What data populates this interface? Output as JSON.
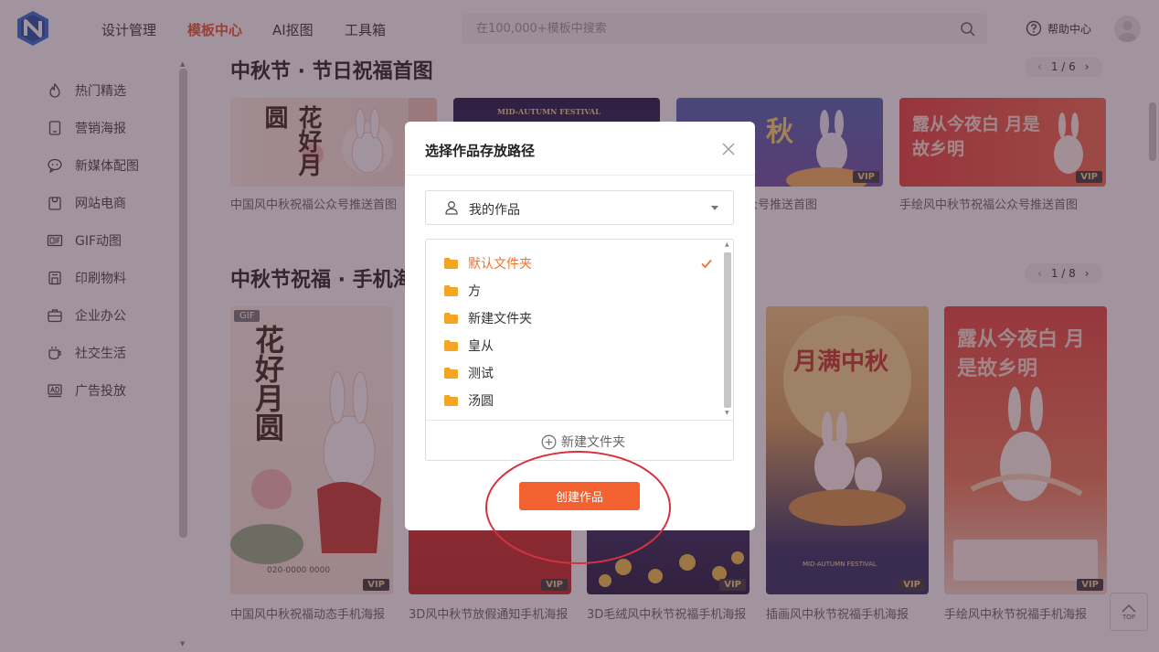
{
  "header": {
    "nav": [
      {
        "label": "设计管理",
        "active": false
      },
      {
        "label": "模板中心",
        "active": true
      },
      {
        "label": "AI抠图",
        "active": false
      },
      {
        "label": "工具箱",
        "active": false
      }
    ],
    "search_placeholder": "在100,000+模板中搜索",
    "help_label": "帮助中心",
    "icons": {
      "logo": "n-logo-icon",
      "search": "search-icon",
      "help": "question-circle-icon",
      "avatar": "user-avatar"
    }
  },
  "sidebar": {
    "items": [
      {
        "label": "热门精选",
        "icon": "flame-icon"
      },
      {
        "label": "营销海报",
        "icon": "tablet-icon"
      },
      {
        "label": "新媒体配图",
        "icon": "chat-icon"
      },
      {
        "label": "网站电商",
        "icon": "shop-bag-icon"
      },
      {
        "label": "GIF动图",
        "icon": "gif-icon"
      },
      {
        "label": "印刷物料",
        "icon": "printer-icon"
      },
      {
        "label": "企业办公",
        "icon": "briefcase-icon"
      },
      {
        "label": "社交生活",
        "icon": "cup-icon"
      },
      {
        "label": "广告投放",
        "icon": "ad-icon"
      }
    ]
  },
  "sections": [
    {
      "title": "中秋节 · 节日祝福首图",
      "pager": "1 / 6",
      "cards": [
        {
          "title": "中国风中秋祝福公众号推送首图",
          "poster_text": "花好月圆",
          "vip": false
        },
        {
          "title": "",
          "poster_text": "MID-AUTUMN FESTIVAL",
          "vip": false
        },
        {
          "title": "福公众号推送首图",
          "poster_text": "秋",
          "vip": true
        },
        {
          "title": "手绘风中秋节祝福公众号推送首图",
          "poster_text": "露从今夜白 月是故乡明",
          "vip": true
        }
      ]
    },
    {
      "title": "中秋节祝福 · 手机海",
      "pager": "1 / 8",
      "cards": [
        {
          "title": "中国风中秋祝福动态手机海报",
          "poster_text": "花好月圆",
          "vip": true,
          "gif": true,
          "footer": "020-0000 0000"
        },
        {
          "title": "3D风中秋节放假通知手机海报",
          "poster_text": "",
          "vip": true,
          "gif": false
        },
        {
          "title": "3D毛绒风中秋节祝福手机海报",
          "poster_text": "",
          "vip": true,
          "gif": false
        },
        {
          "title": "插画风中秋节祝福手机海报",
          "poster_text": "月满中秋",
          "subtext": "MID-AUTUMN FESTIVAL",
          "vip": true,
          "gif": false
        },
        {
          "title": "手绘风中秋节祝福手机海报",
          "poster_text": "露从今夜白 月是故乡明",
          "vip": true,
          "gif": false
        }
      ]
    }
  ],
  "badges": {
    "vip": "VIP",
    "gif": "GIF"
  },
  "top_button": "TOP",
  "dialog": {
    "title": "选择作品存放路径",
    "location": "我的作品",
    "folders": [
      {
        "name": "默认文件夹",
        "selected": true
      },
      {
        "name": "方",
        "selected": false
      },
      {
        "name": "新建文件夹",
        "selected": false
      },
      {
        "name": "皇从",
        "selected": false
      },
      {
        "name": "测试",
        "selected": false
      },
      {
        "name": "汤圆",
        "selected": false
      }
    ],
    "new_folder_label": "新建文件夹",
    "create_button": "创建作品"
  },
  "colors": {
    "accent": "#f2612f",
    "overlay": "#462a3e",
    "annotation": "#d6313e",
    "folder": "#f5a524"
  }
}
